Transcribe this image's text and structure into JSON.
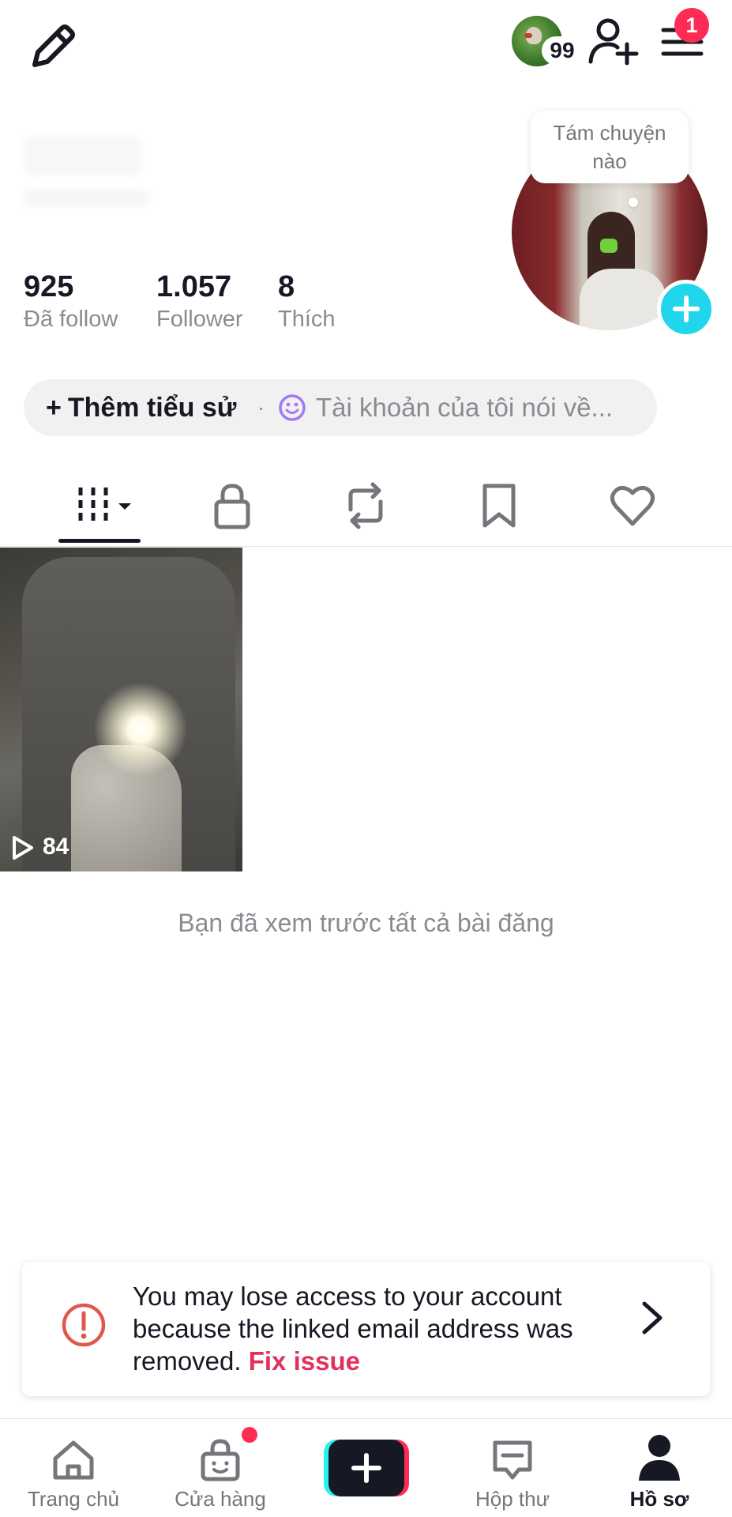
{
  "header": {
    "mini_avatar_count": "99",
    "menu_badge": "1"
  },
  "profile": {
    "bubble_text_line1": "Tám chuyện",
    "bubble_text_line2": "nào",
    "stats": [
      {
        "value": "925",
        "label": "Đã follow"
      },
      {
        "value": "1.057",
        "label": "Follower"
      },
      {
        "value": "8",
        "label": "Thích"
      }
    ]
  },
  "bio": {
    "add_label": "Thêm tiểu sử",
    "separator": "·",
    "hint": "Tài khoản của tôi nói về..."
  },
  "tabs": [
    {
      "icon": "grid-videos-icon",
      "active": true
    },
    {
      "icon": "lock-icon",
      "active": false
    },
    {
      "icon": "repost-icon",
      "active": false
    },
    {
      "icon": "bookmark-icon",
      "active": false
    },
    {
      "icon": "heart-icon",
      "active": false
    }
  ],
  "videos": [
    {
      "views": "84"
    }
  ],
  "seen_all_text": "Bạn đã xem trước tất cả bài đăng",
  "warning": {
    "text": "You may lose access to your account because the linked email address was removed.",
    "link": "Fix issue"
  },
  "nav": {
    "home": "Trang chủ",
    "shop": "Cửa hàng",
    "inbox": "Hộp thư",
    "profile": "Hồ sơ"
  },
  "colors": {
    "accent": "#fe2c55",
    "cyan": "#20d5ec",
    "link": "#e1305c"
  }
}
